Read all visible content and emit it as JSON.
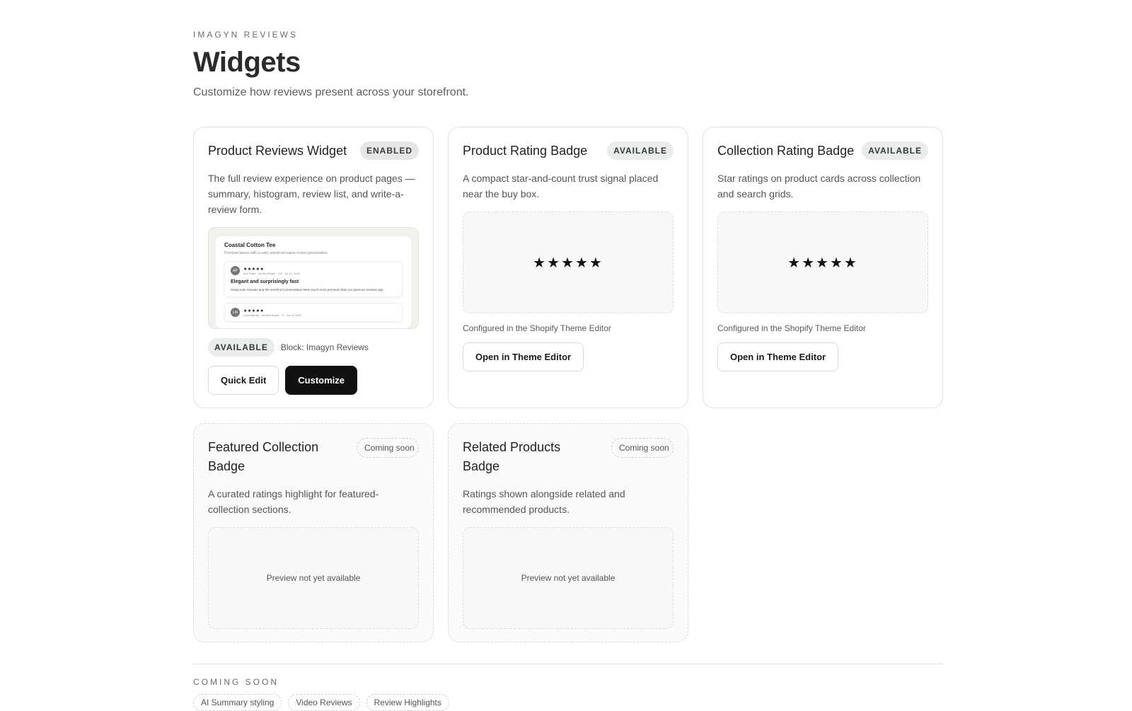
{
  "header": {
    "eyebrow": "IMAGYN REVIEWS",
    "title": "Widgets",
    "subtitle": "Customize how reviews present across your storefront."
  },
  "widgets": [
    {
      "title": "Product Reviews Widget",
      "badge": "ENABLED",
      "description": "The full review experience on product pages — summary, histogram, review list, and write-a-review form.",
      "preview": {
        "product_title": "Coastal Cotton Tee",
        "product_sub": "Premium basics with a calm, storefront-native review presentation.",
        "review1": {
          "initials": "AP",
          "stars": "★★★★★",
          "meta": "Ava Patel · Verified Buyer · US · Jul 12, 2024",
          "title": "Elegant and surprisingly fast",
          "body": "Setup took minutes and the storefront presentation feels much more premium than our previous reviews app."
        },
        "review2": {
          "initials": "LM",
          "stars": "★★★★★",
          "meta": "Luca Moretti · Verified Buyer · IT · Jun 8, 2024"
        }
      },
      "status_badge": "AVAILABLE",
      "status_text": "Block: Imagyn Reviews",
      "quick_edit_label": "Quick Edit",
      "customize_label": "Customize"
    },
    {
      "title": "Product Rating Badge",
      "badge": "AVAILABLE",
      "description": "A compact star-and-count trust signal placed near the buy box.",
      "stars": "★★★★★",
      "configured": "Configured in the Shopify Theme Editor",
      "button_label": "Open in Theme Editor"
    },
    {
      "title": "Collection Rating Badge",
      "badge": "AVAILABLE",
      "description": "Star ratings on product cards across collection and search grids.",
      "stars": "★★★★★",
      "configured": "Configured in the Shopify Theme Editor",
      "button_label": "Open in Theme Editor"
    },
    {
      "title": "Featured Collection Badge",
      "badge": "Coming soon",
      "description": "A curated ratings highlight for featured-collection sections.",
      "preview_text": "Preview not yet available"
    },
    {
      "title": "Related Products Badge",
      "badge": "Coming soon",
      "description": "Ratings shown alongside related and recommended products.",
      "preview_text": "Preview not yet available"
    }
  ],
  "coming_soon": {
    "label": "COMING SOON",
    "chips": [
      "AI Summary styling",
      "Video Reviews",
      "Review Highlights"
    ]
  }
}
